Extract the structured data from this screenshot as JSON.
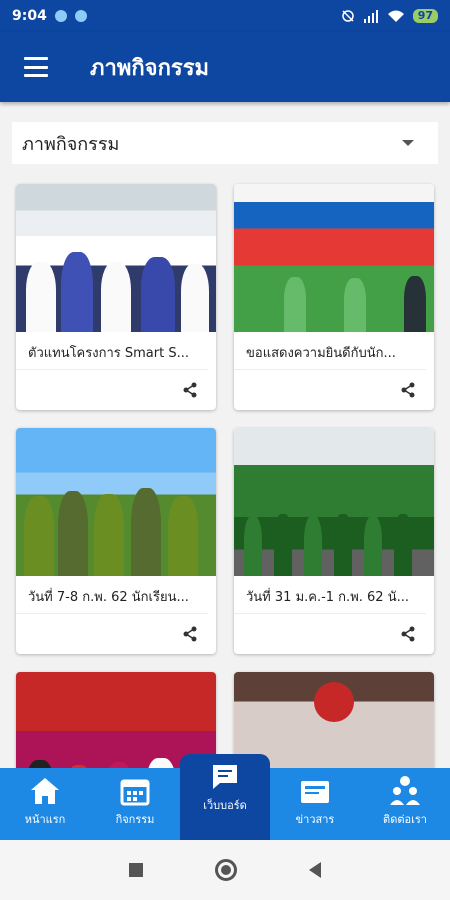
{
  "status": {
    "time": "9:04",
    "battery": "97"
  },
  "app_bar": {
    "title": "ภาพกิจกรรม",
    "menu_icon": "menu-icon"
  },
  "filter": {
    "selected": "ภาพกิจกรรม"
  },
  "cards": [
    {
      "title": "ตัวแทนโครงการ Smart S..."
    },
    {
      "title": "ขอแสดงความยินดีกับนัก..."
    },
    {
      "title": "วันที่ 7-8 ก.พ. 62 นักเรียน..."
    },
    {
      "title": "วันที่ 31 ม.ค.-1 ก.พ. 62 นั..."
    },
    {
      "title": ""
    },
    {
      "title": ""
    }
  ],
  "bottom_nav": [
    {
      "label": "หน้าแรก",
      "icon": "home-icon"
    },
    {
      "label": "กิจกรรม",
      "icon": "calendar-icon"
    },
    {
      "label": "เว็บบอร์ด",
      "icon": "chat-icon",
      "active": true
    },
    {
      "label": "ข่าวสาร",
      "icon": "news-icon"
    },
    {
      "label": "ติดต่อเรา",
      "icon": "contact-icon"
    }
  ],
  "colors": {
    "primary_dark": "#0d47a1",
    "nav_blue": "#1e88e5",
    "battery_green": "#9ccc65"
  }
}
